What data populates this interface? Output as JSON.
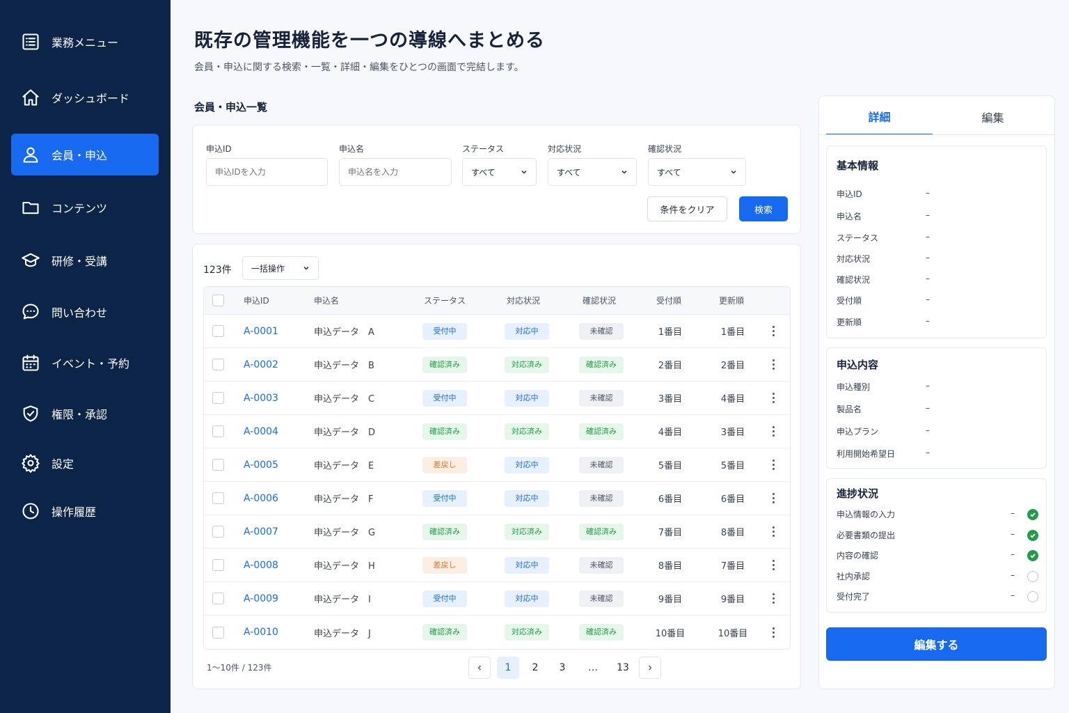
{
  "sidebar": {
    "items": [
      {
        "label": "業務メニュー",
        "icon": "list-icon"
      },
      {
        "label": "ダッシュボード",
        "icon": "home-icon"
      },
      {
        "label": "会員・申込",
        "icon": "user-icon",
        "active": true
      },
      {
        "label": "コンテンツ",
        "icon": "folder-icon"
      },
      {
        "label": "研修・受講",
        "icon": "graduation-cap-icon"
      },
      {
        "label": "問い合わせ",
        "icon": "chat-bubble-icon"
      },
      {
        "label": "イベント・予約",
        "icon": "calendar-icon"
      },
      {
        "label": "権限・承認",
        "icon": "shield-check-icon"
      },
      {
        "label": "設定",
        "icon": "gear-icon"
      },
      {
        "label": "操作履歴",
        "icon": "clock-icon"
      }
    ]
  },
  "header": {
    "title": "既存の管理機能を一つの導線へまとめる",
    "subtitle": "会員・申込に関する検索・一覧・詳細・編集をひとつの画面で完結します。"
  },
  "main": {
    "section_title": "会員・申込一覧",
    "filters": {
      "id_label": "申込ID",
      "id_placeholder": "申込IDを入力",
      "name_label": "申込名",
      "name_placeholder": "申込名を入力",
      "status_label": "ステータス",
      "status_value": "すべて",
      "handling_label": "対応状況",
      "handling_value": "すべて",
      "confirm_label": "確認状況",
      "confirm_value": "すべて",
      "clear_label": "条件をクリア",
      "search_label": "検索"
    },
    "list": {
      "count": "123件",
      "bulk_action": "一括操作",
      "columns": [
        "申込ID",
        "申込名",
        "ステータス",
        "対応状況",
        "確認状況",
        "受付順",
        "更新順"
      ],
      "rows": [
        {
          "id": "A-0001",
          "name": "申込データ　A",
          "status": "受付中",
          "handling": "対応中",
          "confirm": "未確認",
          "received": "1番目",
          "updated": "1番目"
        },
        {
          "id": "A-0002",
          "name": "申込データ　B",
          "status": "確認済み",
          "handling": "対応済み",
          "confirm": "確認済み",
          "received": "2番目",
          "updated": "2番目"
        },
        {
          "id": "A-0003",
          "name": "申込データ　C",
          "status": "受付中",
          "handling": "対応中",
          "confirm": "未確認",
          "received": "3番目",
          "updated": "4番目"
        },
        {
          "id": "A-0004",
          "name": "申込データ　D",
          "status": "確認済み",
          "handling": "対応済み",
          "confirm": "確認済み",
          "received": "4番目",
          "updated": "3番目"
        },
        {
          "id": "A-0005",
          "name": "申込データ　E",
          "status": "差戻し",
          "handling": "対応中",
          "confirm": "未確認",
          "received": "5番目",
          "updated": "5番目"
        },
        {
          "id": "A-0006",
          "name": "申込データ　F",
          "status": "受付中",
          "handling": "対応中",
          "confirm": "未確認",
          "received": "6番目",
          "updated": "6番目"
        },
        {
          "id": "A-0007",
          "name": "申込データ　G",
          "status": "確認済み",
          "handling": "対応済み",
          "confirm": "確認済み",
          "received": "7番目",
          "updated": "8番目"
        },
        {
          "id": "A-0008",
          "name": "申込データ　H",
          "status": "差戻し",
          "handling": "対応中",
          "confirm": "未確認",
          "received": "8番目",
          "updated": "7番目"
        },
        {
          "id": "A-0009",
          "name": "申込データ　I",
          "status": "受付中",
          "handling": "対応中",
          "confirm": "未確認",
          "received": "9番目",
          "updated": "9番目"
        },
        {
          "id": "A-0010",
          "name": "申込データ　J",
          "status": "確認済み",
          "handling": "対応済み",
          "confirm": "確認済み",
          "received": "10番目",
          "updated": "10番目"
        }
      ],
      "range_text": "1〜10件 / 123件",
      "pages": [
        "1",
        "2",
        "3",
        "…",
        "13"
      ],
      "current_page": "1"
    }
  },
  "detail": {
    "tab_detail": "詳細",
    "tab_edit": "編集",
    "basic": {
      "title": "基本情報",
      "fields": [
        {
          "label": "申込ID",
          "value": "–"
        },
        {
          "label": "申込名",
          "value": "–"
        },
        {
          "label": "ステータス",
          "value": "–"
        },
        {
          "label": "対応状況",
          "value": "–"
        },
        {
          "label": "確認状況",
          "value": "–"
        },
        {
          "label": "受付順",
          "value": "–"
        },
        {
          "label": "更新順",
          "value": "–"
        }
      ]
    },
    "content": {
      "title": "申込内容",
      "fields": [
        {
          "label": "申込種別",
          "value": "–"
        },
        {
          "label": "製品名",
          "value": "–"
        },
        {
          "label": "申込プラン",
          "value": "–"
        },
        {
          "label": "利用開始希望日",
          "value": "–"
        }
      ]
    },
    "progress": {
      "title": "進捗状況",
      "steps": [
        {
          "label": "申込情報の入力",
          "value": "–",
          "done": true
        },
        {
          "label": "必要書類の提出",
          "value": "–",
          "done": true
        },
        {
          "label": "内容の確認",
          "value": "–",
          "done": true
        },
        {
          "label": "社内承認",
          "value": "–",
          "done": false
        },
        {
          "label": "受付完了",
          "value": "–",
          "done": false
        }
      ]
    },
    "edit_button": "編集する"
  },
  "colors": {
    "sidebar_bg": "#0b2447",
    "accent": "#1769f0",
    "success": "#1f9d47",
    "warning": "#e8712b"
  }
}
